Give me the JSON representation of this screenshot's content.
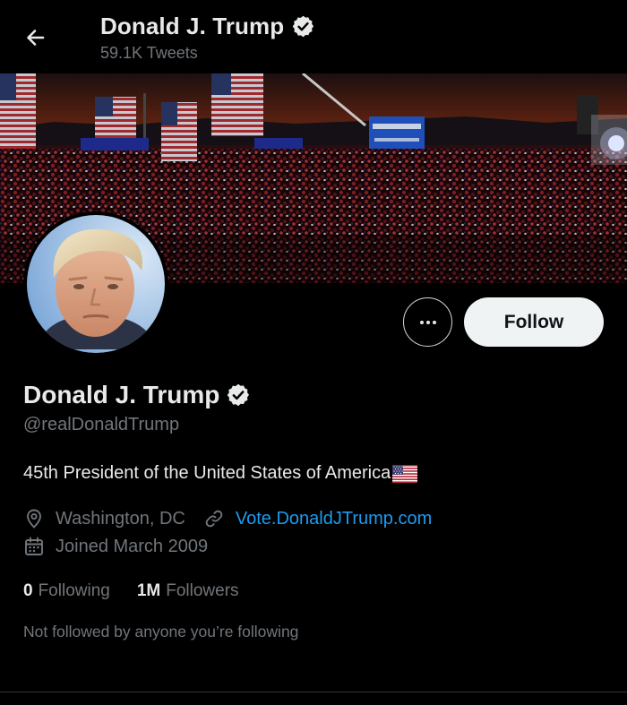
{
  "header": {
    "display_name": "Donald J. Trump",
    "tweet_count": "59.1K Tweets",
    "back_icon": "arrow-left-icon",
    "verified_icon": "verified-badge-icon"
  },
  "banner": {
    "flag_icon": "us-flag-icon"
  },
  "profile": {
    "display_name": "Donald J. Trump",
    "handle": "@realDonaldTrump",
    "bio": "45th President of the United States of America",
    "bio_emoji": "us-flag-emoji",
    "location": "Washington, DC",
    "website": "Vote.DonaldJTrump.com",
    "joined": "Joined March 2009",
    "following_count": "0",
    "following_label": "Following",
    "followers_count": "1M",
    "followers_label": "Followers",
    "not_followed_note": "Not followed by anyone you’re following"
  },
  "actions": {
    "follow_label": "Follow",
    "more_icon": "more-options-icon"
  },
  "colors": {
    "background": "#000000",
    "primary_text": "#e7e9ea",
    "secondary_text": "#71767b",
    "link": "#1d9bf0",
    "follow_bg": "#eff3f4",
    "verified_badge": "#e7e9ea"
  }
}
